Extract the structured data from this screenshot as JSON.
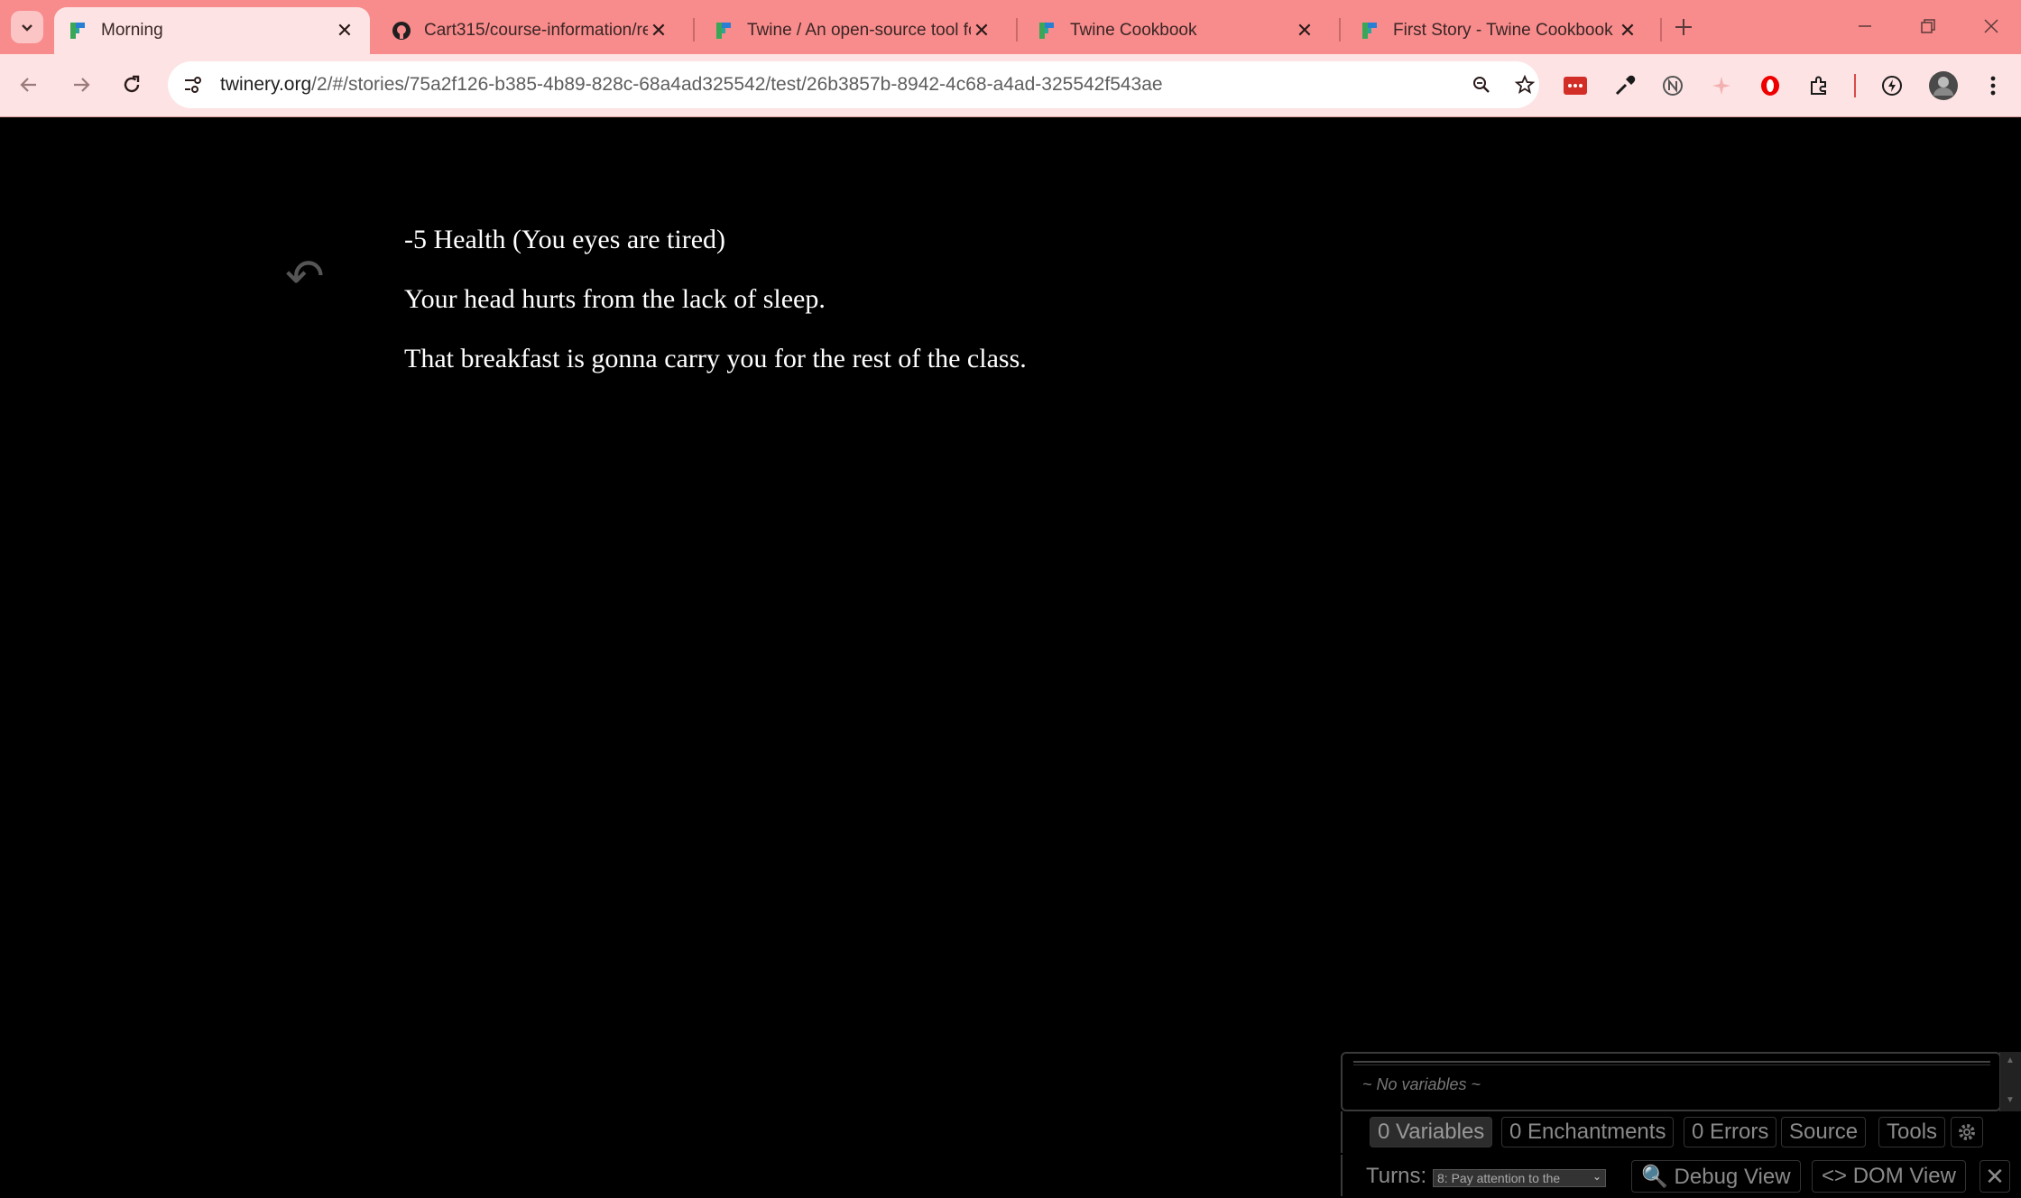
{
  "browser": {
    "tabs": [
      {
        "title": "Morning",
        "icon": "twine-favicon-icon",
        "active": true
      },
      {
        "title": "Cart315/course-information/re",
        "icon": "github-icon",
        "active": false
      },
      {
        "title": "Twine / An open-source tool fo",
        "icon": "twine-favicon-icon",
        "active": false
      },
      {
        "title": "Twine Cookbook",
        "icon": "twine-favicon-icon",
        "active": false
      },
      {
        "title": "First Story - Twine Cookbook",
        "icon": "twine-favicon-icon",
        "active": false
      }
    ],
    "url_domain": "twinery.org",
    "url_path": "/2/#/stories/75a2f126-b385-4b89-828c-68a4ad325542/test/26b3857b-8942-4c68-a4ad-325542f543ae"
  },
  "story": {
    "undo_glyph": "↶",
    "lines": [
      "-5 Health (You eyes are tired)",
      "Your head hurts from the lack of sleep.",
      "That breakfast is gonna carry you for the rest of the class."
    ]
  },
  "debug": {
    "no_variables": "~ No variables ~",
    "tabs": [
      "0 Variables",
      "0 Enchantments",
      "0 Errors",
      "Source",
      "Tools"
    ],
    "turns_label": "Turns:",
    "turns_value": "8: Pay attention to the",
    "debug_view": "🔍 Debug View",
    "dom_view": "<> DOM View",
    "close": "✕"
  },
  "colors": {
    "tabbar": "#f88b8b",
    "toolbar": "#fde3e3",
    "page_bg": "#000000",
    "text": "#ffffff"
  }
}
